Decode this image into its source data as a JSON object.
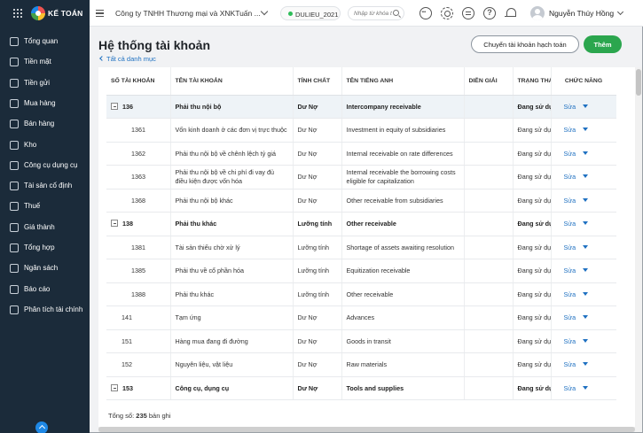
{
  "app": {
    "logo_text": "KẾ TOÁN",
    "company": "Công ty TNHH Thương mại và XNKTuấn ...",
    "database": "DULIEU_2021",
    "search_placeholder": "Nhập từ khóa t",
    "user_name": "Nguyễn Thúy Hồng"
  },
  "sidebar": {
    "items": [
      {
        "label": "Tổng quan",
        "icon": "dashboard-icon"
      },
      {
        "label": "Tiền mặt",
        "icon": "cash-icon"
      },
      {
        "label": "Tiền gửi",
        "icon": "bank-icon"
      },
      {
        "label": "Mua hàng",
        "icon": "purchase-icon"
      },
      {
        "label": "Bán hàng",
        "icon": "cart-icon"
      },
      {
        "label": "Kho",
        "icon": "warehouse-icon"
      },
      {
        "label": "Công cụ dụng cụ",
        "icon": "tools-icon"
      },
      {
        "label": "Tài sản cố định",
        "icon": "asset-icon"
      },
      {
        "label": "Thuế",
        "icon": "tax-icon"
      },
      {
        "label": "Giá thành",
        "icon": "price-icon"
      },
      {
        "label": "Tổng hợp",
        "icon": "summary-icon"
      },
      {
        "label": "Ngân sách",
        "icon": "budget-icon"
      },
      {
        "label": "Báo cáo",
        "icon": "report-icon"
      },
      {
        "label": "Phân tích tài chính",
        "icon": "analytics-icon"
      }
    ]
  },
  "page": {
    "title": "Hệ thống tài khoản",
    "back_link": "Tất cả danh mục",
    "transfer_button": "Chuyển tài khoản hạch toán",
    "add_button": "Thêm",
    "total_label": "Tổng số:",
    "total_count": "235",
    "total_suffix": "bản ghi"
  },
  "table": {
    "columns": [
      "SỐ TÀI KHOẢN",
      "TÊN TÀI KHOẢN",
      "TÍNH CHẤT",
      "TÊN TIẾNG ANH",
      "DIỄN GIẢI",
      "TRẠNG THÁI",
      "CHỨC NĂNG"
    ],
    "action_label": "Sửa",
    "rows": [
      {
        "level": "parent",
        "expand": true,
        "code": "136",
        "name": "Phải thu nội bộ",
        "nature": "Dư Nợ",
        "english": "Intercompany receivable",
        "desc": "",
        "status": "Đang sử dụng"
      },
      {
        "level": "child",
        "code": "1361",
        "name": "Vốn kinh doanh ở các đơn vị trực thuộc",
        "nature": "Dư Nợ",
        "english": "Investment in equity of subsidiaries",
        "desc": "",
        "status": "Đang sử dụng"
      },
      {
        "level": "child",
        "code": "1362",
        "name": "Phải thu nội bộ về chênh lệch tỷ giá",
        "nature": "Dư Nợ",
        "english": "Internal receivable on rate differences",
        "desc": "",
        "status": "Đang sử dụng"
      },
      {
        "level": "child",
        "code": "1363",
        "name": "Phải thu nội bộ về chi phí đi vay đủ điều kiện được vốn hóa",
        "nature": "Dư Nợ",
        "english": "Internal receivable the borrowing costs eligible for capitalization",
        "desc": "",
        "status": "Đang sử dụng"
      },
      {
        "level": "child",
        "code": "1368",
        "name": "Phải thu nội bộ khác",
        "nature": "Dư Nợ",
        "english": "Other receivable from subsidiaries",
        "desc": "",
        "status": "Đang sử dụng"
      },
      {
        "level": "parent",
        "expand": true,
        "code": "138",
        "name": "Phải thu khác",
        "nature": "Lưỡng tính",
        "english": "Other receivable",
        "desc": "",
        "status": "Đang sử dụng"
      },
      {
        "level": "child",
        "code": "1381",
        "name": "Tài sản thiếu chờ xử lý",
        "nature": "Lưỡng tính",
        "english": "Shortage of assets awaiting resolution",
        "desc": "",
        "status": "Đang sử dụng"
      },
      {
        "level": "child",
        "code": "1385",
        "name": "Phải thu về cổ phần hóa",
        "nature": "Lưỡng tính",
        "english": "Equitization receivable",
        "desc": "",
        "status": "Đang sử dụng"
      },
      {
        "level": "child",
        "code": "1388",
        "name": "Phải thu khác",
        "nature": "Lưỡng tính",
        "english": "Other receivable",
        "desc": "",
        "status": "Đang sử dụng"
      },
      {
        "level": "top",
        "code": "141",
        "name": "Tạm ứng",
        "nature": "Dư Nợ",
        "english": "Advances",
        "desc": "",
        "status": "Đang sử dụng"
      },
      {
        "level": "top",
        "code": "151",
        "name": "Hàng mua đang đi đường",
        "nature": "Dư Nợ",
        "english": "Goods in transit",
        "desc": "",
        "status": "Đang sử dụng"
      },
      {
        "level": "top",
        "code": "152",
        "name": "Nguyên liệu, vật liệu",
        "nature": "Dư Nợ",
        "english": "Raw materials",
        "desc": "",
        "status": "Đang sử dụng"
      },
      {
        "level": "parent",
        "expand": true,
        "code": "153",
        "name": "Công cụ, dụng cụ",
        "nature": "Dư Nợ",
        "english": "Tools and supplies",
        "desc": "",
        "status": "Đang sử dụng"
      }
    ]
  }
}
